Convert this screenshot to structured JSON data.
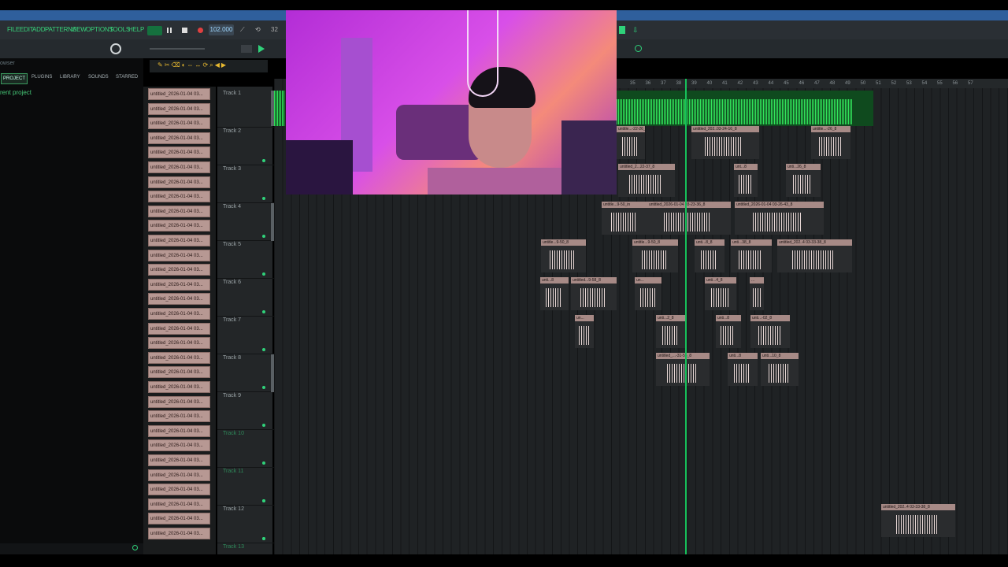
{
  "menu": {
    "items": [
      "FILE",
      "EDIT",
      "ADD",
      "PATTERNS",
      "VIEW",
      "OPTIONS",
      "TOOLS",
      "HELP"
    ]
  },
  "transport": {
    "tempo": "102.000",
    "extra": "32"
  },
  "browser": {
    "title": "owser",
    "tabs": [
      "PROJECT",
      "PLUGINS",
      "LIBRARY",
      "SOUNDS",
      "STARRED"
    ],
    "current": "rent project"
  },
  "patterns": [
    "untitled_2026-01-04 03...",
    "untitled_2026-01-04 03...",
    "untitled_2026-01-04 03...",
    "untitled_2026-01-04 03...",
    "untitled_2026-01-04 03...",
    "untitled_2026-01-04 03...",
    "untitled_2026-01-04 03...",
    "untitled_2026-01-04 03...",
    "untitled_2026-01-04 03...",
    "untitled_2026-01-04 03...",
    "untitled_2026-01-04 03...",
    "untitled_2026-01-04 03...",
    "untitled_2026-01-04 03...",
    "untitled_2026-01-04 03...",
    "untitled_2026-01-04 03...",
    "untitled_2026-01-04 03...",
    "untitled_2026-01-04 03...",
    "untitled_2026-01-04 03...",
    "untitled_2026-01-04 03...",
    "untitled_2026-01-04 03...",
    "untitled_2026-01-04 03...",
    "untitled_2026-01-04 03...",
    "untitled_2026-01-04 03...",
    "untitled_2026-01-04 03...",
    "untitled_2026-01-04 03...",
    "untitled_2026-01-04 03...",
    "untitled_2026-01-04 03...",
    "untitled_2026-01-04 03...",
    "untitled_2026-01-04 03...",
    "untitled_2026-01-04 03...",
    "untitled_2026-01-04 03..."
  ],
  "tracks": [
    "Track 1",
    "Track 2",
    "Track 3",
    "Track 4",
    "Track 5",
    "Track 6",
    "Track 7",
    "Track 8",
    "Track 9",
    "Track 10",
    "Track 11",
    "Track 12",
    "Track 13"
  ],
  "ruler": [
    "35",
    "36",
    "37",
    "38",
    "39",
    "40",
    "41",
    "42",
    "43",
    "44",
    "45",
    "46",
    "47",
    "48",
    "49",
    "50",
    "51",
    "52",
    "53",
    "54",
    "55",
    "56",
    "57"
  ],
  "clips": {
    "t2a": "untitle...-22-26_8",
    "t2b": "untitled_202..03-24-16_8",
    "t2c": "untitle...-26_8",
    "t3a": "untitled_2...22-37_8",
    "t3b": "unt...8",
    "t3c": "unti...26_8",
    "t4a": "untitle...9-50_in",
    "t4b": "untitled_2026-01-04 03-23-36_8",
    "t4c": "untitled_2026-01-04 03-26-43_8",
    "t5a": "untitle...9-50_8",
    "t5b": "untitle...9-50_8",
    "t5c": "unti...8_8",
    "t5d": "unti...38_8",
    "t5e": "untitled_202..4 03-33-38_8",
    "t6a": "unti...8",
    "t6b": "untitled...9-58_8",
    "t6c": "un...",
    "t6d": "unti...4_8",
    "t6e": "...",
    "t7a": "un...",
    "t7b": "unti...2_8",
    "t7c": "unti...8",
    "t7d": "unti...-02_8",
    "t8a": "untitled_...-31-55_8",
    "t8b": "unti...8",
    "t8c": "unti...10_8",
    "t12a": "untitled_202..4 03-33-38_8"
  },
  "colors": {
    "accent": "#2fd27a",
    "clip": "#a78a86",
    "playhead": "#17c05a"
  }
}
